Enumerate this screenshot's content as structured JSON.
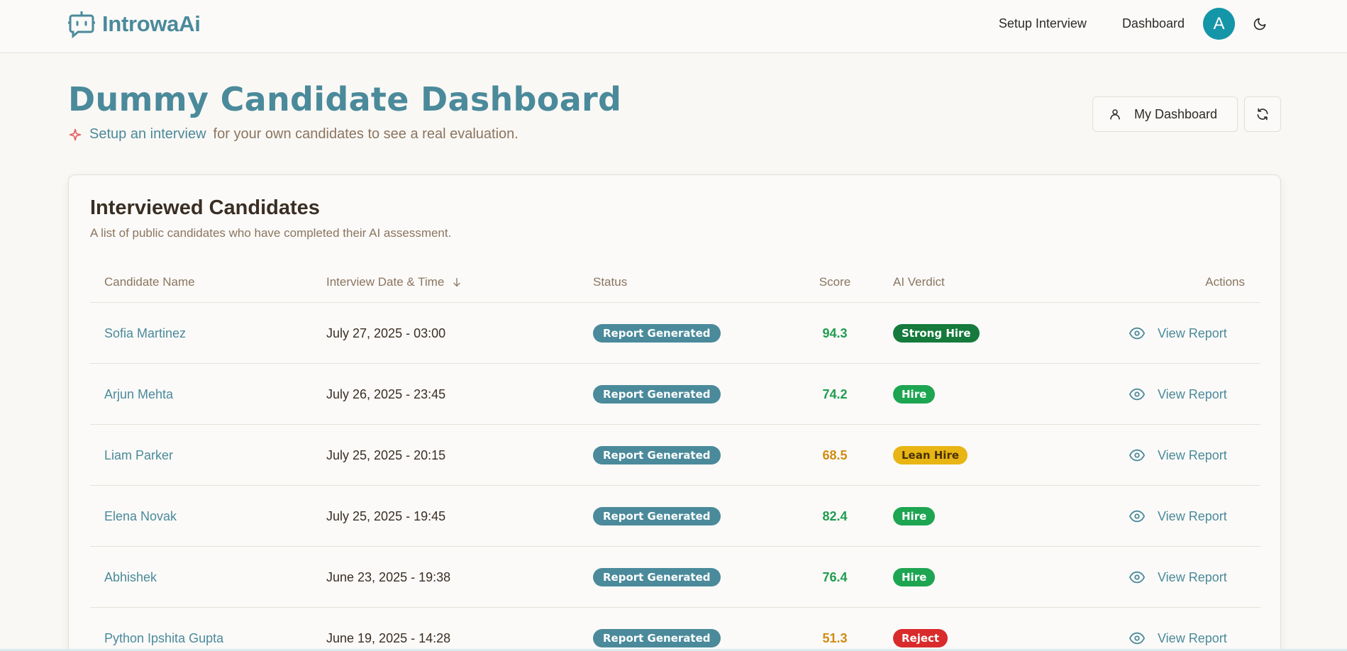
{
  "header": {
    "brand": "IntrowaAi",
    "nav": [
      "Setup Interview",
      "Dashboard"
    ],
    "avatar_initial": "A"
  },
  "page": {
    "title": "Dummy Candidate Dashboard",
    "subtitle_link": "Setup an interview",
    "subtitle_text": "for your own candidates to see a real evaluation.",
    "my_dashboard_label": "My Dashboard"
  },
  "card": {
    "title": "Interviewed Candidates",
    "description": "A list of public candidates who have completed their AI assessment."
  },
  "table": {
    "columns": [
      "Candidate Name",
      "Interview Date & Time",
      "Status",
      "Score",
      "AI Verdict",
      "Actions"
    ],
    "rows": [
      {
        "name": "Sofia Martinez",
        "date": "July 27, 2025 - 03:00",
        "status": "Report Generated",
        "score": "94.3",
        "score_color": "#1f9d4f",
        "verdict": "Strong Hire",
        "verdict_color": "#157a3c",
        "verdict_text_color": "#ffffff",
        "action": "View Report"
      },
      {
        "name": "Arjun Mehta",
        "date": "July 26, 2025 - 23:45",
        "status": "Report Generated",
        "score": "74.2",
        "score_color": "#1f9d4f",
        "verdict": "Hire",
        "verdict_color": "#1ea552",
        "verdict_text_color": "#ffffff",
        "action": "View Report"
      },
      {
        "name": "Liam Parker",
        "date": "July 25, 2025 - 20:15",
        "status": "Report Generated",
        "score": "68.5",
        "score_color": "#d18b12",
        "verdict": "Lean Hire",
        "verdict_color": "#e8b514",
        "verdict_text_color": "#4a3200",
        "action": "View Report"
      },
      {
        "name": "Elena Novak",
        "date": "July 25, 2025 - 19:45",
        "status": "Report Generated",
        "score": "82.4",
        "score_color": "#1f9d4f",
        "verdict": "Hire",
        "verdict_color": "#1ea552",
        "verdict_text_color": "#ffffff",
        "action": "View Report"
      },
      {
        "name": "Abhishek",
        "date": "June 23, 2025 - 19:38",
        "status": "Report Generated",
        "score": "76.4",
        "score_color": "#1f9d4f",
        "verdict": "Hire",
        "verdict_color": "#1ea552",
        "verdict_text_color": "#ffffff",
        "action": "View Report"
      },
      {
        "name": "Python Ipshita Gupta",
        "date": "June 19, 2025 - 14:28",
        "status": "Report Generated",
        "score": "51.3",
        "score_color": "#d18b12",
        "verdict": "Reject",
        "verdict_color": "#d92b2b",
        "verdict_text_color": "#ffffff",
        "action": "View Report"
      }
    ]
  },
  "colors": {
    "accent": "#4a8a9b",
    "avatar": "#1595a8",
    "background": "#faf8f5"
  }
}
